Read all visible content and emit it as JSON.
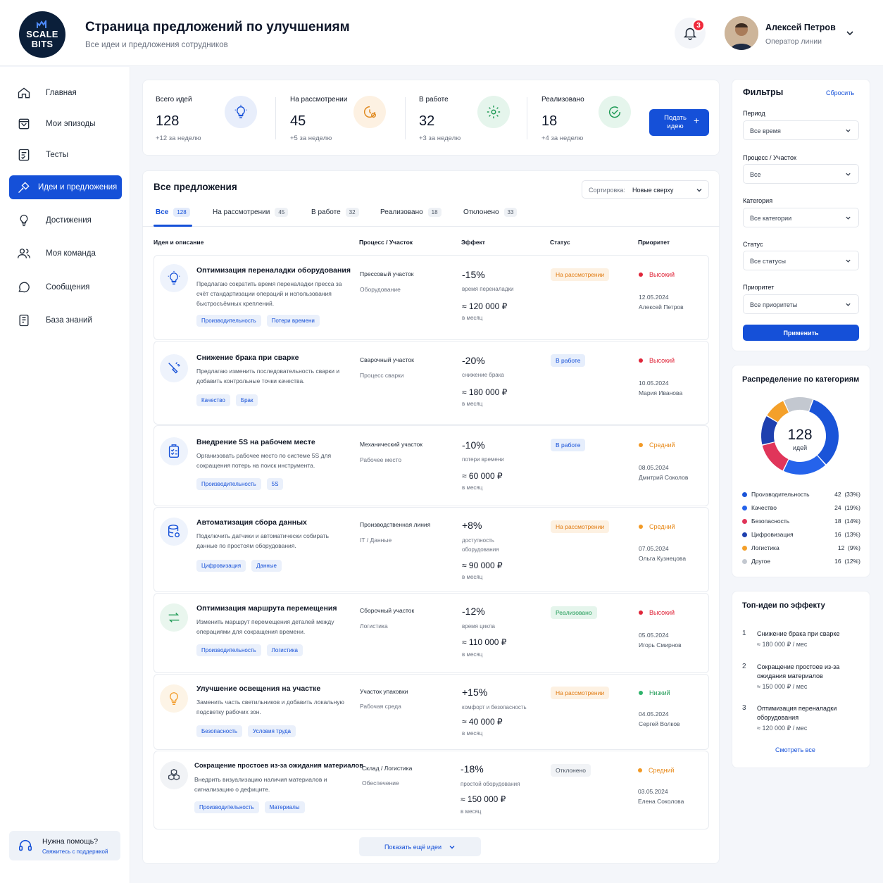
{
  "brand": {
    "logo_line1": "SCALE",
    "logo_line2": "BITS"
  },
  "header": {
    "title": "Страница предложений по улучшениям",
    "subtitle": "Все идеи и предложения сотрудников",
    "notifications_count": "3",
    "user_name": "Алексей Петров",
    "user_role": "Оператор линии"
  },
  "sidebar": {
    "items": [
      {
        "label": "Главная",
        "icon": "home-icon"
      },
      {
        "label": "Мои эпизоды",
        "icon": "episodes-icon"
      },
      {
        "label": "Тесты",
        "icon": "tests-icon"
      },
      {
        "label": "Идеи и предложения",
        "icon": "ideas-icon",
        "active": true
      },
      {
        "label": "Достижения",
        "icon": "achievements-icon"
      },
      {
        "label": "Моя команда",
        "icon": "team-icon"
      },
      {
        "label": "Сообщения",
        "icon": "messages-icon"
      },
      {
        "label": "База знаний",
        "icon": "knowledge-base-icon"
      }
    ],
    "help_title": "Нужна помощь?",
    "help_link": "Свяжитесь с поддержкой"
  },
  "stats": [
    {
      "label": "Всего идей",
      "value": "128",
      "delta": "+12 за неделю",
      "icon": "lightbulb-icon"
    },
    {
      "label": "На рассмотрении",
      "value": "45",
      "delta": "+5 за неделю",
      "icon": "clock-icon"
    },
    {
      "label": "В работе",
      "value": "32",
      "delta": "+3 за неделю",
      "icon": "gear-icon"
    },
    {
      "label": "Реализовано",
      "value": "18",
      "delta": "+4 за неделю",
      "icon": "check-circle-icon"
    }
  ],
  "submit_button": "Подать идею",
  "list": {
    "title": "Все предложения",
    "sort_label": "Сортировка:",
    "sort_value": "Новые сверху",
    "tabs": [
      {
        "label": "Все",
        "count": "128"
      },
      {
        "label": "На рассмотрении",
        "count": "45"
      },
      {
        "label": "В работе",
        "count": "32"
      },
      {
        "label": "Реализовано",
        "count": "18"
      },
      {
        "label": "Отклонено",
        "count": "33"
      }
    ],
    "columns": [
      "Идея и описание",
      "Процесс / Участок",
      "Эффект",
      "Статус",
      "Приоритет"
    ],
    "rows": [
      {
        "title": "Оптимизация переналадки оборудования",
        "desc": "Предлагаю сократить время переналадки пресса за счёт стандартизации операций и использования быстросъёмных креплений.",
        "tags": [
          "Производительность",
          "Потери времени"
        ],
        "process": "Прессовый участок",
        "process_sub": "Оборудование",
        "effect": "-15%",
        "effect_desc": "время переналадки",
        "money": "≈ 120 000 ₽",
        "period": "в месяц",
        "status": "На рассмотрении",
        "priority": "Высокий",
        "date": "12.05.2024",
        "author": "Алексей Петров",
        "icon": "lightbulb-icon"
      },
      {
        "title": "Снижение брака при сварке",
        "desc": "Предлагаю изменить последовательность сварки и добавить контрольные точки качества.",
        "tags": [
          "Качество",
          "Брак"
        ],
        "process": "Сварочный участок",
        "process_sub": "Процесс сварки",
        "effect": "-20%",
        "effect_desc": "снижение брака",
        "money": "≈ 180 000 ₽",
        "period": "в месяц",
        "status": "В работе",
        "priority": "Высокий",
        "date": "10.05.2024",
        "author": "Мария Иванова",
        "icon": "welding-icon"
      },
      {
        "title": "Внедрение 5S на рабочем месте",
        "desc": "Организовать рабочее место по системе 5S для сокращения потерь на поиск инструмента.",
        "tags": [
          "Производительность",
          "5S"
        ],
        "process": "Механический участок",
        "process_sub": "Рабочее место",
        "effect": "-10%",
        "effect_desc": "потери времени",
        "money": "≈ 60 000 ₽",
        "period": "в месяц",
        "status": "В работе",
        "priority": "Средний",
        "date": "08.05.2024",
        "author": "Дмитрий Соколов",
        "icon": "clipboard-icon"
      },
      {
        "title": "Автоматизация сбора данных",
        "desc": "Подключить датчики и автоматически собирать данные по простоям оборудования.",
        "tags": [
          "Цифровизация",
          "Данные"
        ],
        "process": "Производственная линия",
        "process_sub": "IT / Данные",
        "effect": "+8%",
        "effect_desc": "доступность оборудования",
        "money": "≈ 90 000 ₽",
        "period": "в месяц",
        "status": "На рассмотрении",
        "priority": "Средний",
        "date": "07.05.2024",
        "author": "Ольга Кузнецова",
        "icon": "database-icon"
      },
      {
        "title": "Оптимизация маршрута перемещения",
        "desc": "Изменить маршрут перемещения деталей между операциями для сокращения времени.",
        "tags": [
          "Производительность",
          "Логистика"
        ],
        "process": "Сборочный участок",
        "process_sub": "Логистика",
        "effect": "-12%",
        "effect_desc": "время цикла",
        "money": "≈ 110 000 ₽",
        "period": "в месяц",
        "status": "Реализовано",
        "priority": "Высокий",
        "date": "05.05.2024",
        "author": "Игорь Смирнов",
        "icon": "route-arrows-icon"
      },
      {
        "title": "Улучшение освещения на участке",
        "desc": "Заменить часть светильников и добавить локальную подсветку рабочих зон.",
        "tags": [
          "Безопасность",
          "Условия труда"
        ],
        "process": "Участок упаковки",
        "process_sub": "Рабочая среда",
        "effect": "+15%",
        "effect_desc": "комфорт и безопасность",
        "money": "≈ 40 000 ₽",
        "period": "в месяц",
        "status": "На рассмотрении",
        "priority": "Низкий",
        "date": "04.05.2024",
        "author": "Сергей Волков",
        "icon": "light-bulb-icon"
      },
      {
        "title": "Сокращение простоев из-за ожидания материалов",
        "desc": "Внедрить визуализацию наличия материалов и сигнализацию о дефиците.",
        "tags": [
          "Производительность",
          "Материалы"
        ],
        "process": "Склад / Логистика",
        "process_sub": "Обеспечение",
        "effect": "-18%",
        "effect_desc": "простой оборудования",
        "money": "≈ 150 000 ₽",
        "period": "в месяц",
        "status": "Отклонено",
        "priority": "Средний",
        "date": "03.05.2024",
        "author": "Елена Соколова",
        "icon": "boxes-icon"
      }
    ],
    "show_more": "Показать ещё идеи"
  },
  "filters": {
    "title": "Фильтры",
    "reset": "Сбросить",
    "fields": [
      {
        "label": "Период",
        "value": "Все время"
      },
      {
        "label": "Процесс / Участок",
        "value": "Все"
      },
      {
        "label": "Категория",
        "value": "Все категории"
      },
      {
        "label": "Статус",
        "value": "Все статусы"
      },
      {
        "label": "Приоритет",
        "value": "Все приоритеты"
      }
    ],
    "apply": "Применить"
  },
  "categories": {
    "title": "Распределение по категориям",
    "total": "128",
    "total_label": "идей",
    "items": [
      {
        "name": "Производительность",
        "count": "42",
        "pct": "(33%)",
        "value": 42,
        "color": "#1a54d8"
      },
      {
        "name": "Качество",
        "count": "24",
        "pct": "(19%)",
        "value": 24,
        "color": "#2563eb"
      },
      {
        "name": "Безопасность",
        "count": "18",
        "pct": "(14%)",
        "value": 18,
        "color": "#e0355a"
      },
      {
        "name": "Цифровизация",
        "count": "16",
        "pct": "(13%)",
        "value": 16,
        "color": "#1e40af"
      },
      {
        "name": "Логистика",
        "count": "12",
        "pct": "(9%)",
        "value": 12,
        "color": "#f4a02a"
      },
      {
        "name": "Другое",
        "count": "16",
        "pct": "(12%)",
        "value": 16,
        "color": "#c3c8d0"
      }
    ]
  },
  "top_ideas": {
    "title": "Топ-идеи по эффекту",
    "items": [
      {
        "rank": "1",
        "title": "Снижение брака при сварке",
        "value": "≈ 180 000 ₽ / мес"
      },
      {
        "rank": "2",
        "title": "Сокращение простоев из-за ожидания материалов",
        "value": "≈ 150 000 ₽ / мес"
      },
      {
        "rank": "3",
        "title": "Оптимизация переналадки оборудования",
        "value": "≈ 120 000 ₽ / мес"
      }
    ],
    "view_all": "Смотреть все"
  }
}
